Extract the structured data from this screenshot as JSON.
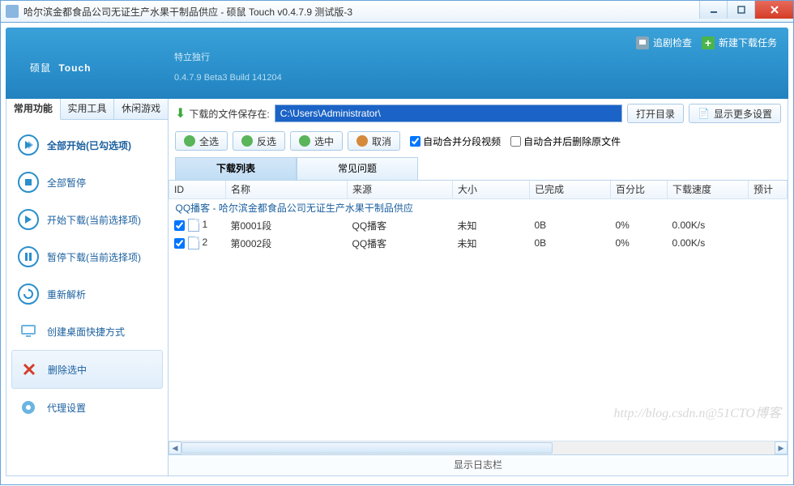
{
  "window": {
    "title": "哈尔滨金都食品公司无证生产水果干制品供应 - 硕鼠 Touch v0.4.7.9 测试版-3"
  },
  "header": {
    "logo_main": "硕鼠",
    "logo_sub": "Touch",
    "tagline": "特立独行",
    "version": "0.4.7.9 Beta3 Build 141204",
    "btn_track": "追剧检查",
    "btn_new": "新建下载任务"
  },
  "side": {
    "tabs": [
      "常用功能",
      "实用工具",
      "休闲游戏"
    ],
    "items": [
      {
        "label": "全部开始(已勾选项)"
      },
      {
        "label": "全部暂停"
      },
      {
        "label": "开始下载(当前选择项)"
      },
      {
        "label": "暂停下载(当前选择项)"
      },
      {
        "label": "重新解析"
      },
      {
        "label": "创建桌面快捷方式"
      },
      {
        "label": "删除选中"
      },
      {
        "label": "代理设置"
      }
    ]
  },
  "path": {
    "label": "下载的文件保存在:",
    "value": "C:\\Users\\Administrator\\",
    "open_btn": "打开目录",
    "more_btn": "显示更多设置"
  },
  "actions": {
    "select_all": "全选",
    "invert": "反选",
    "check": "选中",
    "cancel": "取消",
    "auto_merge_seg": "自动合并分段视频",
    "auto_delete_src": "自动合并后删除原文件"
  },
  "tabs": {
    "list": "下载列表",
    "faq": "常见问题"
  },
  "table": {
    "headers": [
      "ID",
      "名称",
      "来源",
      "大小",
      "已完成",
      "百分比",
      "下载速度",
      "预计"
    ],
    "group": "QQ播客 - 哈尔滨金都食品公司无证生产水果干制品供应",
    "rows": [
      {
        "id": "1",
        "name": "第0001段",
        "source": "QQ播客",
        "size": "未知",
        "done": "0B",
        "pct": "0%",
        "speed": "0.00K/s"
      },
      {
        "id": "2",
        "name": "第0002段",
        "source": "QQ播客",
        "size": "未知",
        "done": "0B",
        "pct": "0%",
        "speed": "0.00K/s"
      }
    ]
  },
  "status": "显示日志栏",
  "watermark": "http://blog.csdn.n@51CTO博客"
}
